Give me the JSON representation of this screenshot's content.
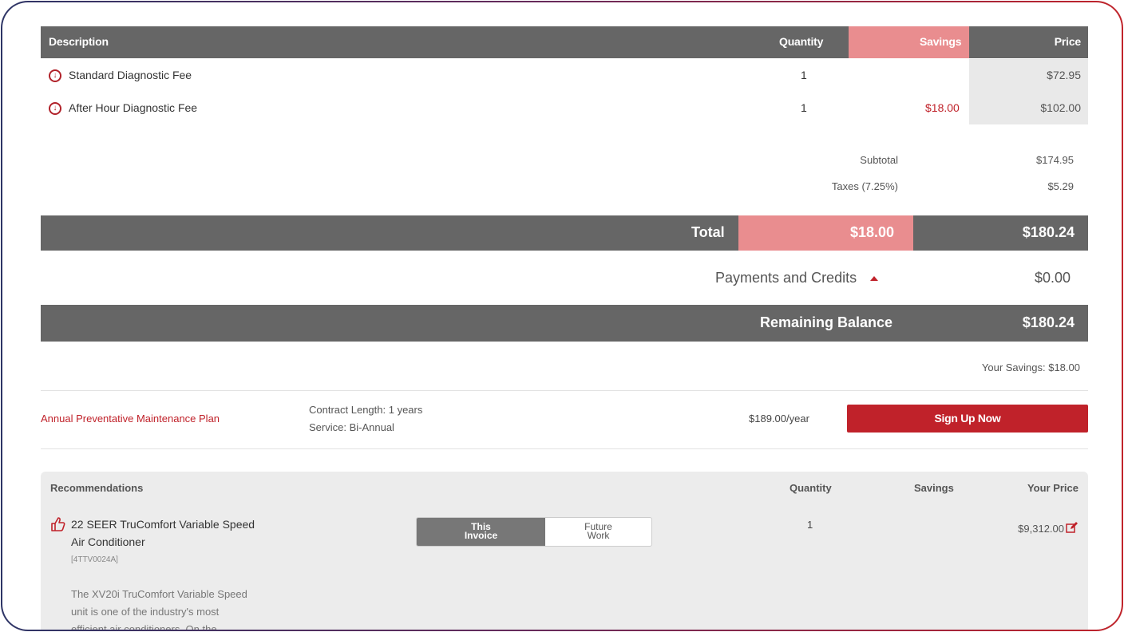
{
  "table_header": {
    "description": "Description",
    "quantity": "Quantity",
    "savings": "Savings",
    "price": "Price"
  },
  "line_items": [
    {
      "icon": "download-circle-icon",
      "description": "Standard Diagnostic Fee",
      "quantity": "1",
      "savings": "",
      "price": "$72.95"
    },
    {
      "icon": "download-circle-icon",
      "description": "After Hour Diagnostic Fee",
      "quantity": "1",
      "savings": "$18.00",
      "price": "$102.00"
    }
  ],
  "summary": {
    "subtotal_label": "Subtotal",
    "subtotal": "$174.95",
    "taxes_label": "Taxes (7.25%)",
    "taxes": "$5.29"
  },
  "total": {
    "label": "Total",
    "savings": "$18.00",
    "amount": "$180.24"
  },
  "payments": {
    "label": "Payments and Credits",
    "amount": "$0.00",
    "icon": "caret-up-icon"
  },
  "remaining": {
    "label": "Remaining Balance",
    "amount": "$180.24"
  },
  "your_savings": "Your Savings: $18.00",
  "plan": {
    "name": "Annual Preventative Maintenance Plan",
    "contract_length": "Contract Length: 1 years",
    "service": "Service: Bi-Annual",
    "price": "$189.00/year",
    "button": "Sign Up Now"
  },
  "recommendations": {
    "header": {
      "title": "Recommendations",
      "quantity": "Quantity",
      "savings": "Savings",
      "your_price": "Your Price"
    },
    "item": {
      "icon": "thumbs-up-icon",
      "name_line1": "22 SEER TruComfort Variable Speed",
      "name_line2": "Air Conditioner",
      "sku": "[4TTV0024A]",
      "toggle_on_line1": "This",
      "toggle_on_line2": "Invoice",
      "toggle_off_line1": "Future",
      "toggle_off_line2": "Work",
      "quantity": "1",
      "price": "$9,312.00",
      "edit_icon": "edit-icon",
      "desc_line1": "The XV20i TruComfort Variable Speed",
      "desc_line2": "unit is one of the industry's most",
      "desc_line3": "efficient air conditioners. On the"
    }
  },
  "colors": {
    "accent_red": "#c0222a",
    "savings_pink": "#e98d8f",
    "header_gray": "#666666"
  }
}
